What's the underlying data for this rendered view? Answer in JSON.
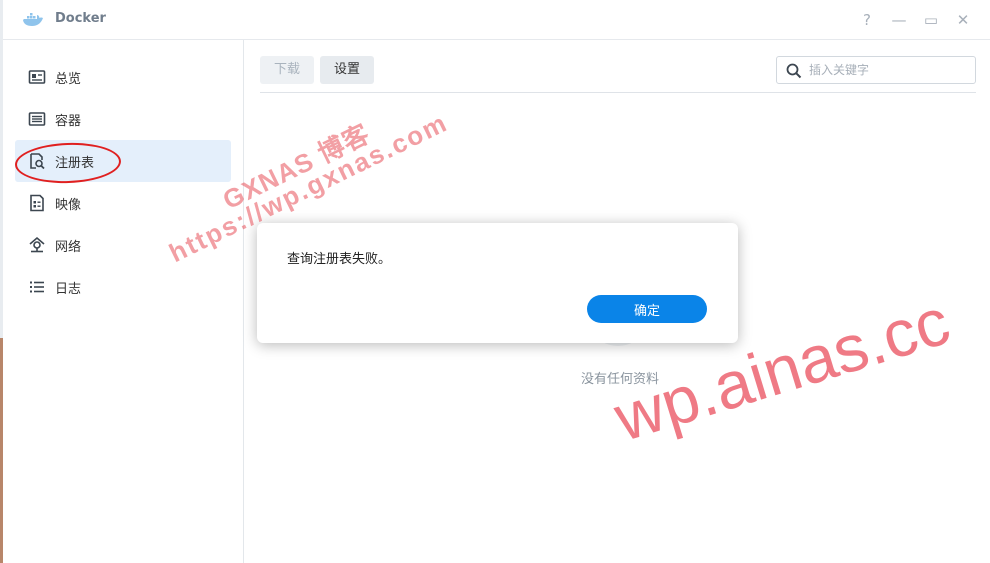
{
  "window": {
    "title": "Docker",
    "controls": {
      "help": "?",
      "minimize": "—",
      "maximize": "▭",
      "close": "✕"
    }
  },
  "sidebar": {
    "items": [
      {
        "label": "总览",
        "icon": "overview-icon",
        "active": false
      },
      {
        "label": "容器",
        "icon": "container-icon",
        "active": false
      },
      {
        "label": "注册表",
        "icon": "registry-icon",
        "active": true
      },
      {
        "label": "映像",
        "icon": "image-icon",
        "active": false
      },
      {
        "label": "网络",
        "icon": "network-icon",
        "active": false
      },
      {
        "label": "日志",
        "icon": "log-icon",
        "active": false
      }
    ]
  },
  "toolbar": {
    "download_label": "下载",
    "settings_label": "设置",
    "search_placeholder": "插入关键字"
  },
  "main": {
    "empty_text": "没有任何资料"
  },
  "dialog": {
    "message": "查询注册表失败。",
    "ok_label": "确定"
  },
  "watermarks": {
    "line1": "GXNAS 博客",
    "line2": "https://wp.gxnas.com",
    "line3": "wp.ainas.cc"
  },
  "colors": {
    "accent": "#0a84e8",
    "active_nav_bg": "#e4effb",
    "annotation_red": "#e02020"
  }
}
